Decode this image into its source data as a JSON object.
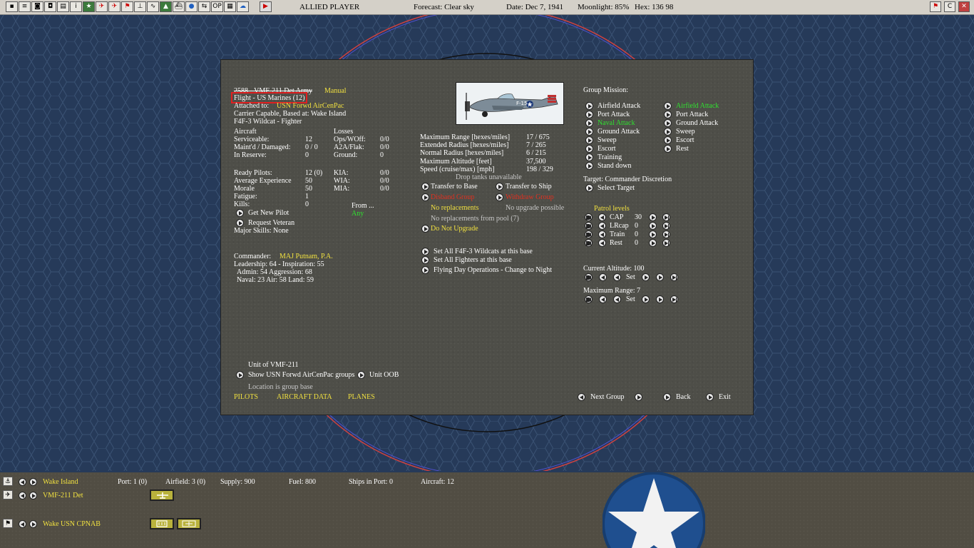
{
  "toolbar": {
    "left_icons": [
      "map-icon",
      "report-icon",
      "unit-icon",
      "group-icon",
      "list-icon",
      "info-icon",
      "star-icon",
      "aircraft-icon",
      "fighter-icon",
      "flag-icon",
      "plane-icon",
      "route-icon",
      "base-icon",
      "ship-icon",
      "globe-icon",
      "op-icon",
      "grid-icon",
      "swap-icon"
    ],
    "op_label": "OP",
    "info_label": "i",
    "side": "ALLIED PLAYER",
    "forecast": "Forecast: Clear sky",
    "date": "Date: Dec 7, 1941",
    "moonlight": "Moonlight: 85%",
    "hex": "Hex: 136 98",
    "right_c": "C"
  },
  "group": {
    "name": "2588 - VMF-211 Det Army",
    "mode": "Manual",
    "flight": "Flight - US Marines (12)",
    "attached_label": "Attached to:",
    "attached_value": "USN Forwd AirCenPac",
    "carrier_line": "Carrier Capable, Based at:  Wake Island",
    "aircraft_type": "F4F-3 Wildcat - Fighter",
    "aircraft_header": "Aircraft",
    "losses_header": "Losses",
    "serviceable_label": "Serviceable:",
    "serviceable": "12",
    "maintd_label": "Maint'd / Damaged:",
    "maintd": "0 / 0",
    "reserve_label": "In Reserve:",
    "reserve": "0",
    "opswoff_label": "Ops/WOff:",
    "opswoff": "0/0",
    "a2a_label": "A2A/Flak:",
    "a2a": "0/0",
    "ground_label": "Ground:",
    "ground": "0",
    "ready_label": "Ready Pilots:",
    "ready": "12 (0)",
    "exp_label": "Average Experience",
    "exp": "50",
    "morale_label": "Morale",
    "morale": "50",
    "fatigue_label": "Fatigue:",
    "fatigue": "1",
    "kills_label": "Kills:",
    "kills": "0",
    "kia_label": "KIA:",
    "kia": "0/0",
    "wia_label": "WIA:",
    "wia": "0/0",
    "mia_label": "MIA:",
    "mia": "0/0",
    "get_new_pilot": "Get New Pilot",
    "from_label": "From ...",
    "from_value": "Any",
    "request_veteran": "Request Veteran",
    "major_skills": "Major Skills:  None",
    "commander_label": "Commander:",
    "commander": "MAJ Putnam, P.A.",
    "leadership": "Leadership: 64 - Inspiration: 55",
    "admin": "Admin:  54  Aggression:  68",
    "naval": "Naval:  23  Air:  58  Land:  59",
    "unit_of": "Unit of VMF-211",
    "show_groups": "Show USN Forwd AirCenPac groups",
    "unit_oob": "Unit OOB",
    "location": "Location is group base",
    "tab_pilots": "PILOTS",
    "tab_aircraft": "AIRCRAFT DATA",
    "tab_planes": "PLANES"
  },
  "performance": {
    "max_range_label": "Maximum Range [hexes/miles]",
    "max_range": "17 / 675",
    "ext_radius_label": "Extended Radius [hexes/miles]",
    "ext_radius": "7 / 265",
    "norm_radius_label": "Normal Radius [hexes/miles]",
    "norm_radius": "6 / 215",
    "max_alt_label": "Maximum Altitude [feet]",
    "max_alt": "37,500",
    "speed_label": "Speed (cruise/max) [mph]",
    "speed": "198 / 329",
    "drop_tanks": "Drop tanks unavailable",
    "transfer_base": "Transfer to Base",
    "transfer_ship": "Transfer to Ship",
    "disband": "Disband Group",
    "withdraw": "Withdraw Group",
    "no_replacements": "No replacements",
    "no_upgrade": "No upgrade possible",
    "no_pool": "No replacements from pool (7)",
    "do_not_upgrade": "Do Not Upgrade",
    "set_all_wildcats": "Set All F4F-3 Wildcats at this base",
    "set_all_fighters": "Set All Fighters at this base",
    "flying_day": "Flying Day Operations - Change to Night",
    "plane_marking": "F-15"
  },
  "mission": {
    "header": "Group Mission:",
    "left": [
      "Airfield Attack",
      "Port Attack",
      "Naval Attack",
      "Ground Attack",
      "Sweep",
      "Escort",
      "Training",
      "Stand down"
    ],
    "right": [
      "Airfield Attack",
      "Port Attack",
      "Ground Attack",
      "Sweep",
      "Escort",
      "Rest"
    ],
    "target": "Target: Commander Discretion",
    "select_target": "Select Target",
    "patrol_header": "Patrol levels",
    "patrol": [
      {
        "label": "CAP",
        "value": "30"
      },
      {
        "label": "LRcap",
        "value": "0"
      },
      {
        "label": "Train",
        "value": "0"
      },
      {
        "label": "Rest",
        "value": "0"
      }
    ],
    "altitude": "Current Altitude: 100",
    "max_range": "Maximum Range: 7",
    "set": "Set",
    "next_group": "Next Group",
    "back": "Back",
    "exit": "Exit"
  },
  "bottom": {
    "base": "Wake Island",
    "port": "Port: 1 (0)",
    "airfield": "Airfield: 3 (0)",
    "supply": "Supply: 900",
    "fuel": "Fuel: 800",
    "ships": "Ships in Port: 0",
    "aircraft": "Aircraft: 12",
    "group": "VMF-211 Det",
    "hq": "Wake USN CPNAB"
  },
  "colors": {
    "yellow": "#f0e040",
    "green": "#30e030",
    "red": "#e03020",
    "panel": "#4e4e48",
    "map": "#263a59"
  }
}
